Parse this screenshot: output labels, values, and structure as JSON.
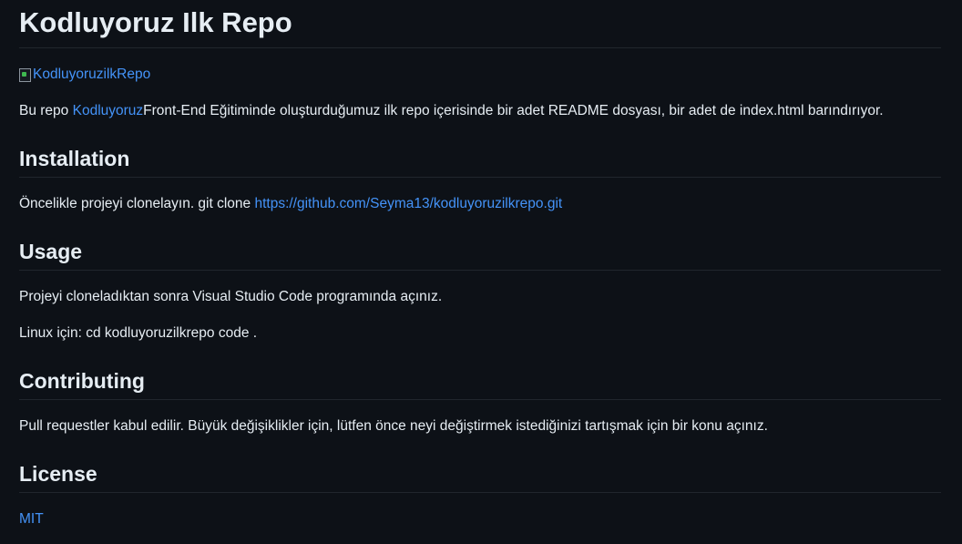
{
  "title": "Kodluyoruz Ilk Repo",
  "badge": {
    "alt": "KodluyoruzilkRepo"
  },
  "intro": {
    "prefix": "Bu repo ",
    "link": "Kodluyoruz",
    "suffix": "Front-End Eğitiminde oluşturduğumuz ilk repo içerisinde bir adet README dosyası, bir adet de index.html barındırıyor."
  },
  "installation": {
    "heading": "Installation",
    "text": "Öncelikle projeyi clonelayın. git clone ",
    "link": "https://github.com/Seyma13/kodluyoruzilkrepo.git"
  },
  "usage": {
    "heading": "Usage",
    "line1": "Projeyi cloneladıktan sonra Visual Studio Code programında açınız.",
    "line2": "Linux için: cd kodluyoruzilkrepo code ."
  },
  "contributing": {
    "heading": "Contributing",
    "text": "Pull requestler kabul edilir. Büyük değişiklikler için, lütfen önce neyi değiştirmek istediğinizi tartışmak için bir konu açınız."
  },
  "license": {
    "heading": "License",
    "link": "MIT"
  },
  "colors": {
    "background": "#0d1117",
    "text": "#e6edf3",
    "link": "#4493f8",
    "rule": "#21262d"
  }
}
